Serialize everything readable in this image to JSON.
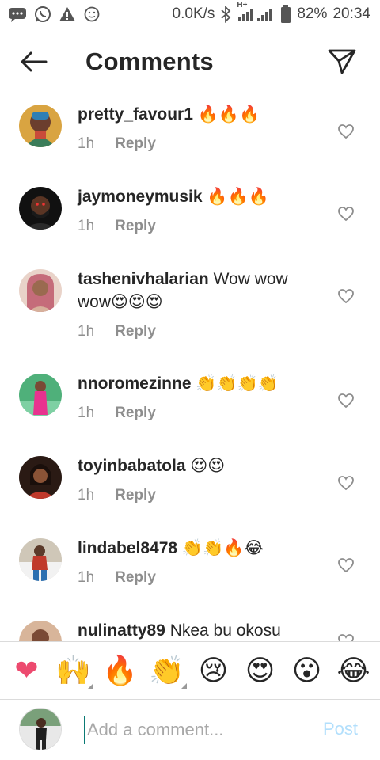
{
  "status_bar": {
    "speed": "0.0K/s",
    "network": "H+",
    "battery": "82%",
    "time": "20:34",
    "icons": [
      "messages-icon",
      "whatsapp-icon",
      "warning-icon",
      "smiley-icon",
      "bluetooth-icon",
      "signal-icon",
      "battery-icon"
    ]
  },
  "header": {
    "title": "Comments",
    "back_icon": "arrow-left-icon",
    "share_icon": "paper-plane-icon"
  },
  "comments": [
    {
      "username": "pretty_favour1",
      "text": "🔥🔥🔥",
      "time": "1h",
      "reply": "Reply"
    },
    {
      "username": "jaymoneymusik",
      "text": "🔥🔥🔥",
      "time": "1h",
      "reply": "Reply"
    },
    {
      "username": "tashenivhalarian",
      "text": "Wow wow wow😍😍😍",
      "time": "1h",
      "reply": "Reply"
    },
    {
      "username": "nnoromezinne",
      "text": "👏👏👏👏",
      "time": "1h",
      "reply": "Reply"
    },
    {
      "username": "toyinbabatola",
      "text": "😍😍",
      "time": "1h",
      "reply": "Reply"
    },
    {
      "username": "lindabel8478",
      "text": "👏👏🔥😂",
      "time": "1h",
      "reply": "Reply"
    },
    {
      "username": "nulinatty89",
      "text": "Nkea bu okosu",
      "time": "",
      "reply": ""
    }
  ],
  "emoji_bar": [
    "❤",
    "🙌",
    "🔥",
    "👏",
    "😢",
    "😍",
    "😮",
    "😂"
  ],
  "composer": {
    "placeholder": "Add a comment...",
    "post_label": "Post"
  },
  "colors": {
    "text": "#262626",
    "muted": "#8e8e8e",
    "post_disabled": "#b2dffc",
    "heart_emoji": "#ed4a6f"
  }
}
